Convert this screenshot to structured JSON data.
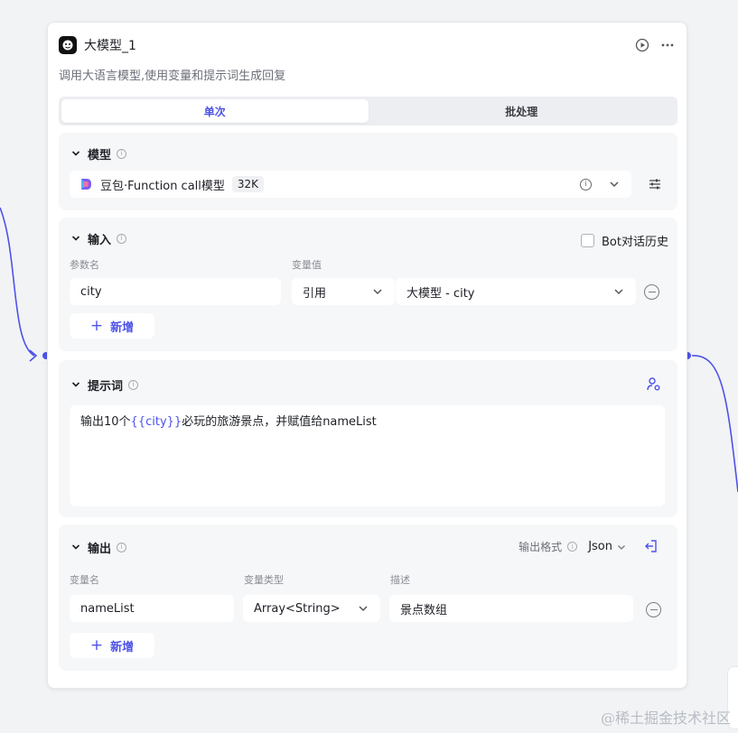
{
  "node": {
    "title": "大模型_1",
    "description": "调用大语言模型,使用变量和提示词生成回复",
    "tabs": [
      {
        "label": "单次",
        "active": true
      },
      {
        "label": "批处理",
        "active": false
      }
    ]
  },
  "model_section": {
    "title": "模型",
    "model_name": "豆包·Function call模型",
    "context_tag": "32K"
  },
  "input_section": {
    "title": "输入",
    "bot_history_label": "Bot对话历史",
    "col_param_name": "参数名",
    "col_var_value": "变量值",
    "rows": [
      {
        "name": "city",
        "ref_type": "引用",
        "ref_value": "大模型 - city"
      }
    ],
    "add_label": "新增"
  },
  "prompt_section": {
    "title": "提示词",
    "text_before": "输出10个",
    "variable": "{{city}}",
    "text_after": "必玩的旅游景点，并赋值给nameList"
  },
  "output_section": {
    "title": "输出",
    "format_label": "输出格式",
    "format_value": "Json",
    "col_var_name": "变量名",
    "col_var_type": "变量类型",
    "col_desc": "描述",
    "rows": [
      {
        "name": "nameList",
        "type": "Array<String>",
        "desc": "景点数组"
      }
    ],
    "add_label": "新增"
  },
  "watermark": "@稀土掘金技术社区",
  "colors": {
    "accent": "#4d53e8",
    "connector": "#4d53e8",
    "background": "#f2f3f5",
    "section_bg": "#f6f7f8"
  }
}
